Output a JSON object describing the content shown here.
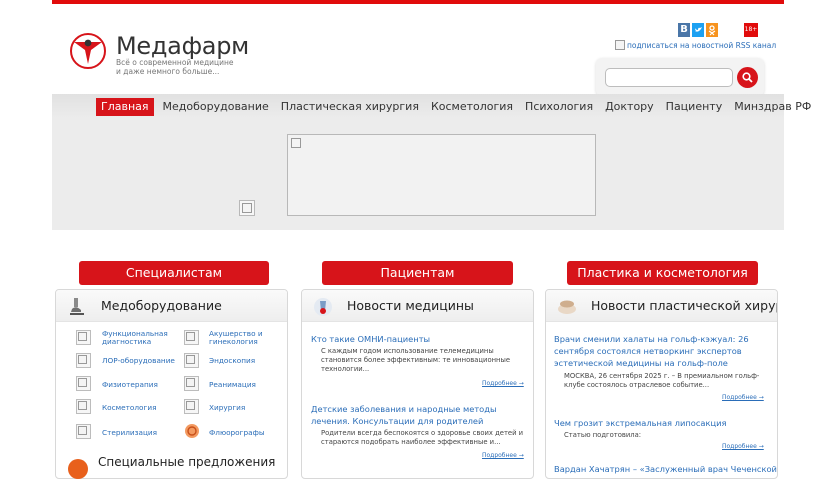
{
  "site": {
    "name": "Медафарм",
    "tagline": "Всё о современной медицине и даже немного больше..."
  },
  "social": [
    {
      "label": "В",
      "color": "#4a76a8"
    },
    {
      "label": "",
      "color": "#1da1f2"
    },
    {
      "label": "",
      "color": "#f7931e"
    },
    {
      "label": "18+",
      "color": "#e10b0b"
    }
  ],
  "rss": {
    "label": "подписаться на новостной RSS канал"
  },
  "search": {
    "placeholder": "",
    "value": ""
  },
  "nav": [
    "Главная",
    "Медоборудование",
    "Пластическая хирургия",
    "Косметология",
    "Психология",
    "Доктору",
    "Пациенту",
    "Минздрав РФ"
  ],
  "categories": [
    "Специалистам",
    "Пациентам",
    "Пластика и косметология"
  ],
  "equipment": {
    "title": "Медоборудование",
    "items": [
      "Функциональная диагностика",
      "Акушерство и гинекология",
      "ЛОР-оборудование",
      "Эндоскопия",
      "Физиотерапия",
      "Реанимация",
      "Косметология",
      "Хирургия",
      "Стерилизация",
      "Флюорографы"
    ]
  },
  "special_offers": "Специальные предложения",
  "medical_news": {
    "title": "Новости медицины",
    "more": "Подробнее →",
    "items": [
      {
        "title": "Кто такие ОМНИ-пациенты",
        "text": "С каждым годом использование телемедицины становится более эффективным: те инновационные технологии..."
      },
      {
        "title": "Детские заболевания и народные методы лечения. Консультации для родителей",
        "text": "Родители всегда беспокоятся о здоровье своих детей и стараются подобрать наиболее эффективные и..."
      }
    ]
  },
  "plastic_news": {
    "title": "Новости пластической хирургии",
    "more": "Подробнее →",
    "items": [
      {
        "title": "Врачи сменили халаты на гольф-кэжуал: 26 сентября состоялся нетворкинг экспертов эстетической медицины на гольф-поле",
        "text": "МОСКВА, 26 сентября 2025 г. – В премиальном гольф-клубе состоялось отраслевое событие..."
      },
      {
        "title": "Чем грозит экстремальная липосакция",
        "text": "Статью подготовила:"
      },
      {
        "title": "Вардан Хачатрян – «Заслуженный врач Чеченской",
        "text": ""
      }
    ]
  }
}
